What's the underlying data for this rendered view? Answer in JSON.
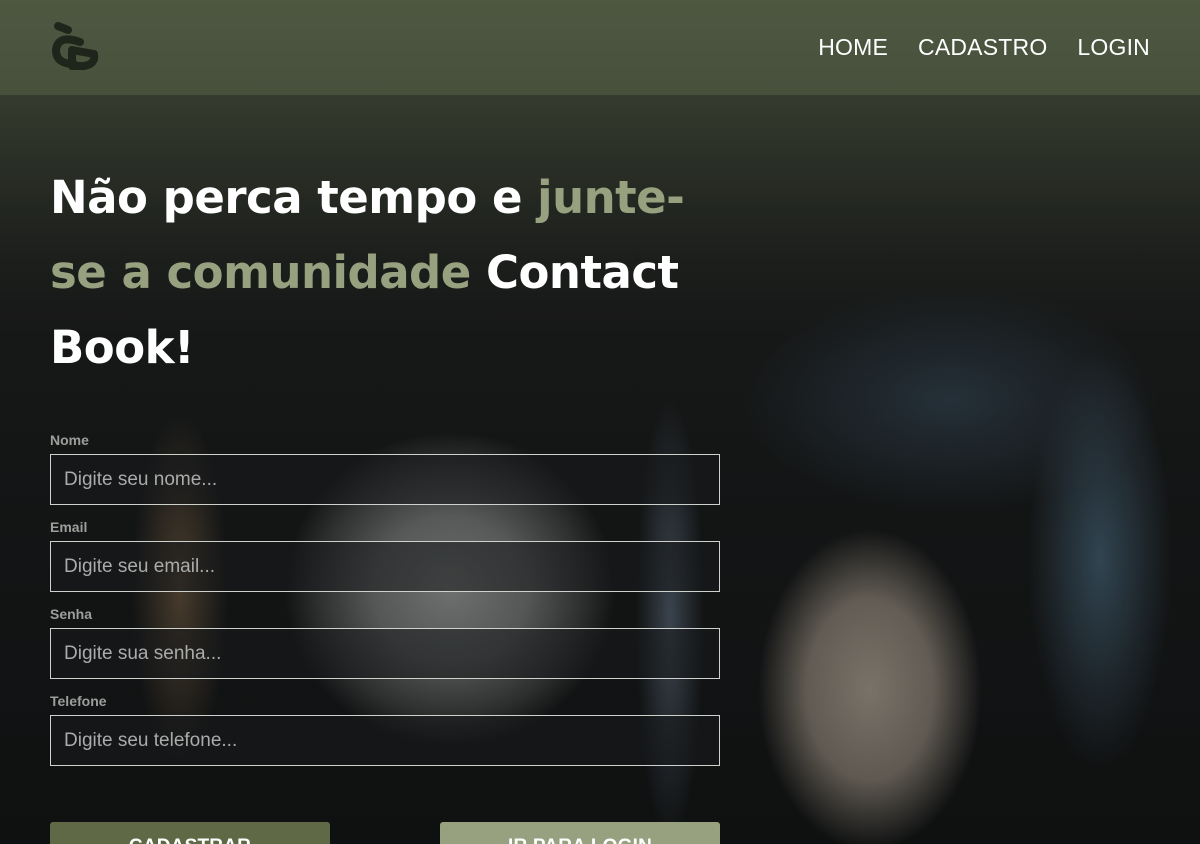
{
  "brand": {
    "logo_icon": "contact-book-logo-icon",
    "logo_color": "#20251c"
  },
  "nav": {
    "items": [
      {
        "label": "HOME"
      },
      {
        "label": "CADASTRO"
      },
      {
        "label": "LOGIN"
      }
    ]
  },
  "hero": {
    "part1": "Não perca tempo e ",
    "accent1": "junte-se a comunidade",
    "part2": " Contact Book!",
    "accent_color": "#98a17f"
  },
  "form": {
    "fields": [
      {
        "label": "Nome",
        "placeholder": "Digite seu nome...",
        "value": ""
      },
      {
        "label": "Email",
        "placeholder": "Digite seu email...",
        "value": ""
      },
      {
        "label": "Senha",
        "placeholder": "Digite sua senha...",
        "value": ""
      },
      {
        "label": "Telefone",
        "placeholder": "Digite seu telefone...",
        "value": ""
      }
    ],
    "submit_label": "CADASTRAR",
    "login_label": "IR PARA LOGIN",
    "submit_color": "#606945",
    "login_color": "#98a17f"
  }
}
